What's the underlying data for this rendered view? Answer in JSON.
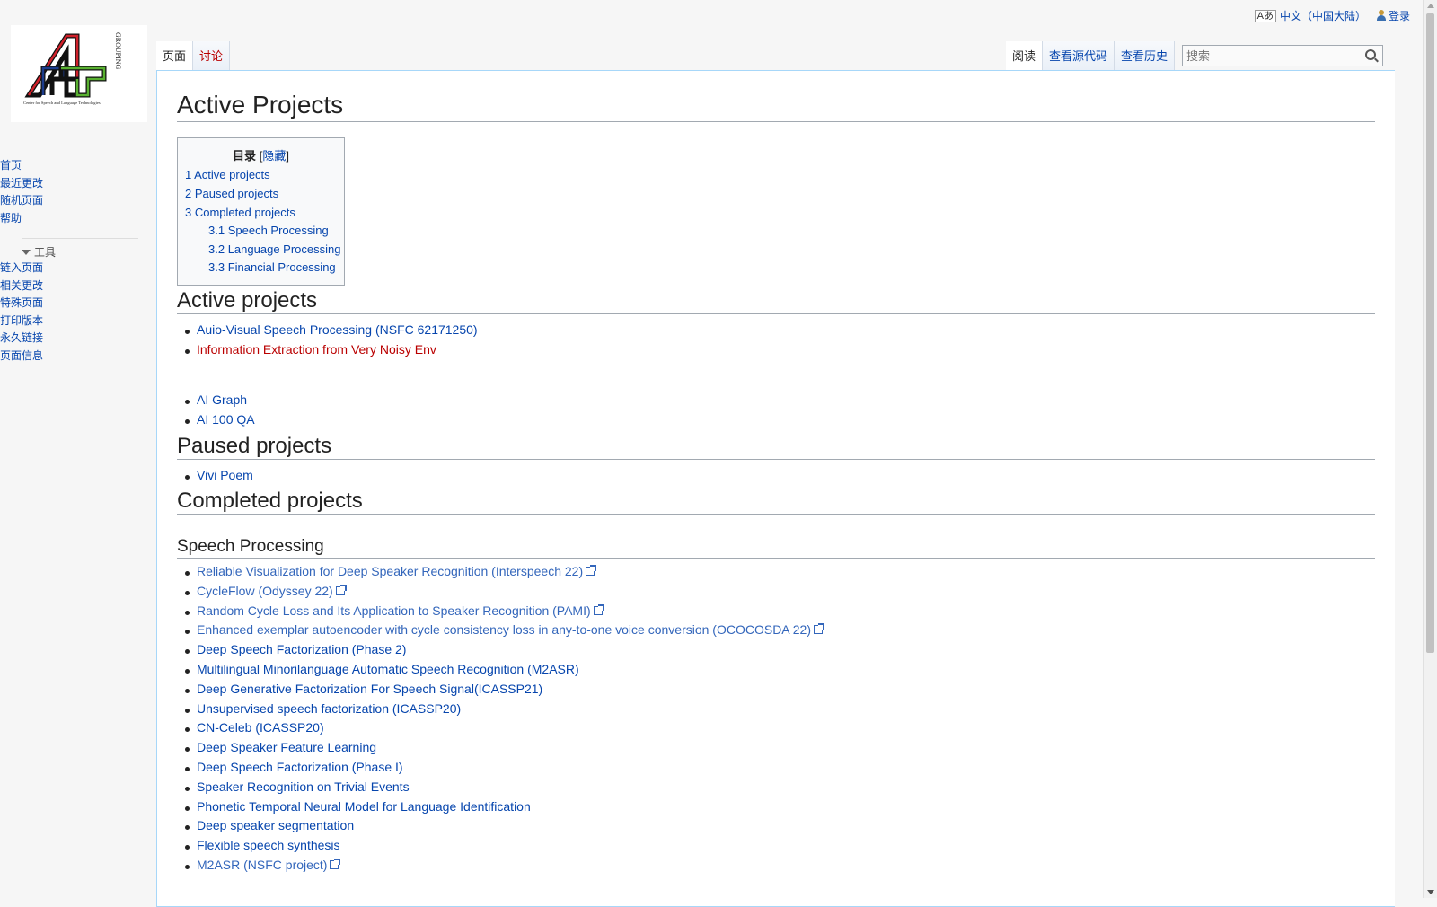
{
  "personal": {
    "uls_icon": "Aあ",
    "language": "中文（中国大陆）",
    "login": "登录"
  },
  "logo": {
    "vertical_text": "GROUPING",
    "caption": "Center for Speech and Language Technologies",
    "colors": {
      "red": "#d0202a",
      "blue": "#1c3c8c",
      "green": "#58b030",
      "black": "#111111"
    }
  },
  "sidebar": {
    "nav": [
      {
        "label": "首页"
      },
      {
        "label": "最近更改"
      },
      {
        "label": "随机页面"
      },
      {
        "label": "帮助"
      }
    ],
    "tools_heading": "工具",
    "tools": [
      {
        "label": "链入页面"
      },
      {
        "label": "相关更改"
      },
      {
        "label": "特殊页面"
      },
      {
        "label": "打印版本"
      },
      {
        "label": "永久链接"
      },
      {
        "label": "页面信息"
      }
    ]
  },
  "tabs": {
    "page": "页面",
    "talk": "讨论",
    "read": "阅读",
    "view_source": "查看源代码",
    "history": "查看历史"
  },
  "search": {
    "placeholder": "搜索"
  },
  "page": {
    "title": "Active Projects",
    "toc": {
      "title": "目录",
      "toggle": "隐藏",
      "items": [
        {
          "num": "1",
          "text": "Active projects"
        },
        {
          "num": "2",
          "text": "Paused projects"
        },
        {
          "num": "3",
          "text": "Completed projects"
        },
        {
          "num": "3.1",
          "text": "Speech Processing"
        },
        {
          "num": "3.2",
          "text": "Language Processing"
        },
        {
          "num": "3.3",
          "text": "Financial Processing"
        }
      ]
    },
    "sections": {
      "active": {
        "heading": "Active projects",
        "items": [
          {
            "text": "Auio-Visual Speech Processing (NSFC 62171250)",
            "type": "internal"
          },
          {
            "text": "Information Extraction from Very Noisy Env",
            "type": "new"
          }
        ],
        "items2": [
          {
            "text": "AI Graph",
            "type": "internal"
          },
          {
            "text": "AI 100 QA",
            "type": "internal"
          }
        ]
      },
      "paused": {
        "heading": "Paused projects",
        "items": [
          {
            "text": "Vivi Poem",
            "type": "internal"
          }
        ]
      },
      "completed": {
        "heading": "Completed projects"
      },
      "speech": {
        "heading": "Speech Processing",
        "items": [
          {
            "text": "Reliable Visualization for Deep Speaker Recognition (Interspeech 22)",
            "type": "external"
          },
          {
            "text": "CycleFlow (Odyssey 22)",
            "type": "external"
          },
          {
            "text": "Random Cycle Loss and Its Application to Speaker Recognition (PAMI)",
            "type": "external"
          },
          {
            "text": "Enhanced exemplar autoencoder with cycle consistency loss in any-to-one voice conversion (OCOCOSDA 22)",
            "type": "external"
          },
          {
            "text": "Deep Speech Factorization (Phase 2)",
            "type": "internal"
          },
          {
            "text": "Multilingual Minorilanguage Automatic Speech Recognition (M2ASR)",
            "type": "internal"
          },
          {
            "text": "Deep Generative Factorization For Speech Signal(ICASSP21)",
            "type": "internal"
          },
          {
            "text": "Unsupervised speech factorization (ICASSP20)",
            "type": "internal"
          },
          {
            "text": "CN-Celeb (ICASSP20)",
            "type": "internal"
          },
          {
            "text": "Deep Speaker Feature Learning",
            "type": "internal"
          },
          {
            "text": "Deep Speech Factorization (Phase I)",
            "type": "internal"
          },
          {
            "text": "Speaker Recognition on Trivial Events",
            "type": "internal"
          },
          {
            "text": "Phonetic Temporal Neural Model for Language Identification",
            "type": "internal"
          },
          {
            "text": "Deep speaker segmentation",
            "type": "internal"
          },
          {
            "text": "Flexible speech synthesis",
            "type": "internal"
          },
          {
            "text": "M2ASR (NSFC project)",
            "type": "external"
          }
        ]
      }
    }
  }
}
